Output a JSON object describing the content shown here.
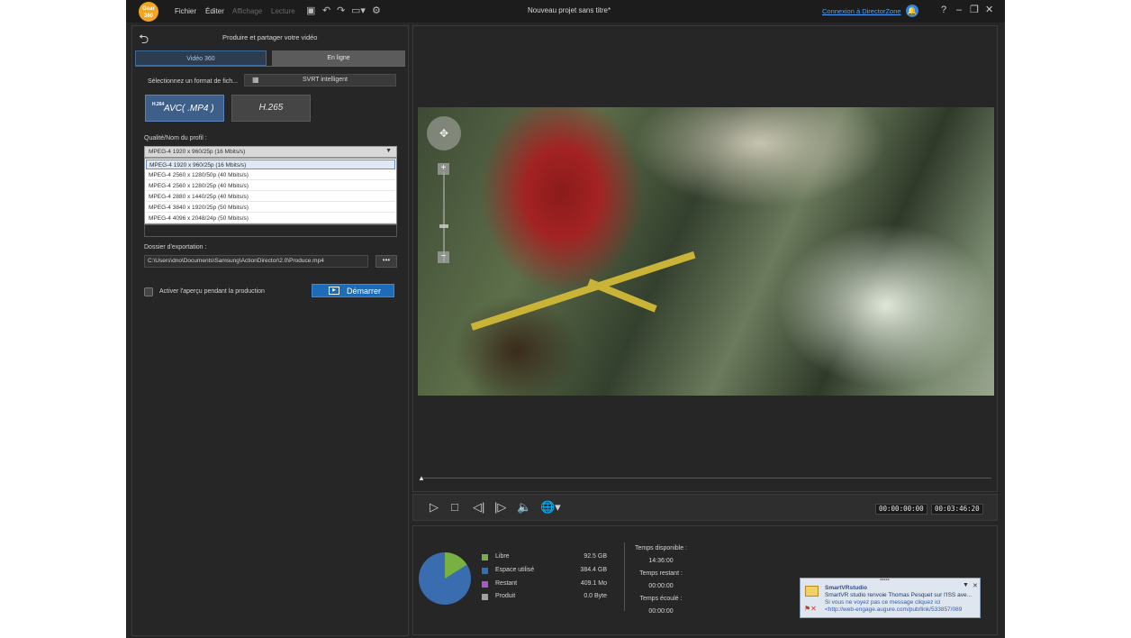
{
  "app": {
    "logo_text": "Gear 360",
    "title": "Nouveau projet sans titre*",
    "login_link": "Connexion à DirectorZone",
    "menu": [
      {
        "label": "Fichier",
        "enabled": true
      },
      {
        "label": "Éditer",
        "enabled": true
      },
      {
        "label": "Affichage",
        "enabled": false
      },
      {
        "label": "Lecture",
        "enabled": false
      }
    ],
    "window_buttons": [
      "?",
      "–",
      "❐",
      "✕"
    ]
  },
  "produce_panel": {
    "title": "Produire et partager votre vidéo",
    "tabs": [
      {
        "label": "Vidéo 360",
        "active": true
      },
      {
        "label": "En ligne",
        "active": false
      }
    ],
    "format_label": "Sélectionnez un format de fich...",
    "svrt_label": "SVRT intelligent",
    "codecs": [
      {
        "superscript": "H.264",
        "label": "AVC( .MP4 )",
        "selected": true
      },
      {
        "superscript": "",
        "label": "H.265",
        "selected": false
      }
    ],
    "quality_label": "Qualité/Nom du profil :",
    "quality_selected": "MPEG-4 1920 x 960/25p (16 Mbits/s)",
    "quality_options": [
      "MPEG-4 1920 x 960/25p (16 Mbits/s)",
      "MPEG-4 2560 x 1280/50p (40 Mbits/s)",
      "MPEG-4 2560 x 1280/25p (40 Mbits/s)",
      "MPEG-4 2880 x 1440/25p (40 Mbits/s)",
      "MPEG-4 3840 x 1920/25p (50 Mbits/s)",
      "MPEG-4 4096 x 2048/24p (50 Mbits/s)"
    ],
    "export_label": "Dossier d'exportation :",
    "export_path": "C:\\Users\\dno\\Documents\\Samsung\\ActionDirector\\2.0\\Produce.mp4",
    "browse_label": "•••",
    "preview_checkbox_label": "Activer l'aperçu pendant la production",
    "preview_checked": false,
    "start_label": "Démarrer"
  },
  "player": {
    "time_current": "00:00:00:00",
    "time_total": "00:03:46:20",
    "position": 0
  },
  "disk": {
    "legend": [
      {
        "label": "Libre",
        "value": "92.5 GB",
        "color": "#78b041"
      },
      {
        "label": "Espace utilisé",
        "value": "384.4 GB",
        "color": "#3a6db0"
      },
      {
        "label": "Restant",
        "value": "409.1 Mo",
        "color": "#a35cc7"
      },
      {
        "label": "Produit",
        "value": "0.0 Byte",
        "color": "#a0a0a0"
      }
    ],
    "times": [
      {
        "label": "Temps disponible :",
        "value": "14:36:00"
      },
      {
        "label": "Temps restant :",
        "value": "00:00:00"
      },
      {
        "label": "Temps écoulé :",
        "value": "00:00:00"
      }
    ]
  },
  "notification": {
    "title": "SmartVRstudio",
    "line1": "SmartVR studio renvoie Thomas Pesquet sur l'ISS ave...",
    "line2": "Si vous ne voyez pas ce message cliquez ici",
    "line3": "<http://web-engage.augure.com/pub/link/533857/089"
  }
}
